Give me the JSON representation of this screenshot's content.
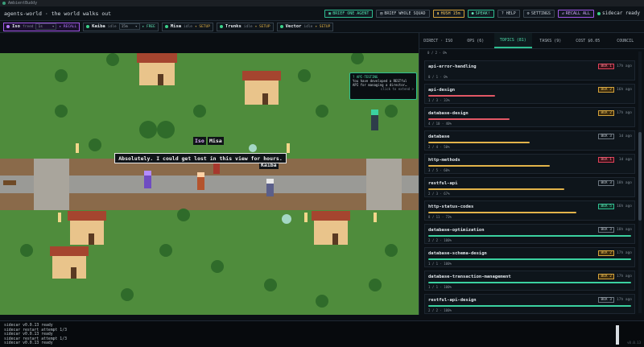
{
  "window": {
    "app_name": "AmbientBuddy"
  },
  "header": {
    "title": "agents-world · the world walks out",
    "buttons": [
      {
        "label": "BRIEF ONE AGENT",
        "style": "green"
      },
      {
        "label": "BRIEF WHOLE SQUAD",
        "style": "plain"
      },
      {
        "label": "HUSH 15m",
        "style": "amber"
      },
      {
        "label": "SPEAK!",
        "style": "mint"
      },
      {
        "label": "? HELP",
        "style": "plain"
      },
      {
        "label": "SETTINGS",
        "style": "plain"
      },
      {
        "label": "RECALL ALL",
        "style": "purple"
      }
    ],
    "status": "sidecar ready"
  },
  "agents": [
    {
      "name": "Iso",
      "state": "freed",
      "select": "1s",
      "action": "RECALL",
      "active": true
    },
    {
      "name": "Kaiba",
      "state": "idle",
      "select": "15m",
      "action": "FREE"
    },
    {
      "name": "Misa",
      "state": "idle",
      "action": "SETUP"
    },
    {
      "name": "Trunks",
      "state": "idle",
      "action": "SETUP"
    },
    {
      "name": "Vector",
      "state": "idle",
      "action": "SETUP"
    }
  ],
  "game": {
    "dialogue": "Absolutely. I could get lost in this view for hours.",
    "nameplates": [
      "Iso",
      "Misa",
      "Kaiba"
    ],
    "tooltip": {
      "head": "? API-TESTING",
      "body": "You have developed a RESTful API for managing a director…",
      "cta": "click to extend >"
    }
  },
  "panel": {
    "tabs": [
      "DIRECT · ISO",
      "OPS (6)",
      "TOPICS (81)",
      "TASKS (9)",
      "COST $0.05",
      "COUNCIL"
    ],
    "active_tab": 2,
    "top_stat": "0 / 2 · 0%",
    "topics": [
      {
        "name": "api-error-handling",
        "badge": "BOX 1",
        "badge_style": "red",
        "age": "17h ago",
        "progress": 0.0,
        "bar_style": "red",
        "stat": "0 / 1 · 0%"
      },
      {
        "name": "api-design",
        "badge": "BOX 2",
        "badge_style": "amber",
        "age": "16h ago",
        "progress": 0.33,
        "bar_style": "red",
        "stat": "1 / 3 · 33%"
      },
      {
        "name": "database-design",
        "badge": "BOX 2",
        "badge_style": "amber",
        "age": "17h ago",
        "progress": 0.4,
        "bar_style": "red",
        "stat": "4 / 10 · 40%"
      },
      {
        "name": "database",
        "badge": "BOX 3",
        "badge_style": "plain",
        "age": "1d ago",
        "progress": 0.5,
        "bar_style": "amber",
        "stat": "2 / 4 · 50%"
      },
      {
        "name": "http-methods",
        "badge": "BOX 1",
        "badge_style": "red",
        "age": "1d ago",
        "progress": 0.6,
        "bar_style": "amber",
        "stat": "3 / 5 · 60%"
      },
      {
        "name": "restful-api",
        "badge": "BOX 3",
        "badge_style": "plain",
        "age": "18h ago",
        "progress": 0.67,
        "bar_style": "amber",
        "stat": "2 / 3 · 67%"
      },
      {
        "name": "http-status-codes",
        "badge": "BOX 5",
        "badge_style": "green",
        "age": "16h ago",
        "progress": 0.73,
        "bar_style": "amber",
        "stat": "8 / 11 · 73%"
      },
      {
        "name": "database-optimization",
        "badge": "BOX 3",
        "badge_style": "plain",
        "age": "18h ago",
        "progress": 1.0,
        "bar_style": "green",
        "stat": "2 / 2 · 100%"
      },
      {
        "name": "database-schema-design",
        "badge": "BOX 2",
        "badge_style": "amber",
        "age": "17h ago",
        "progress": 1.0,
        "bar_style": "green",
        "stat": "1 / 1 · 100%"
      },
      {
        "name": "database-transaction-management",
        "badge": "BOX 2",
        "badge_style": "amber",
        "age": "17h ago",
        "progress": 1.0,
        "bar_style": "green",
        "stat": "1 / 1 · 100%"
      },
      {
        "name": "restful-api-design",
        "badge": "BOX 3",
        "badge_style": "plain",
        "age": "17h ago",
        "progress": 1.0,
        "bar_style": "green",
        "stat": "2 / 2 · 100%"
      }
    ]
  },
  "log": {
    "lines": [
      "sidecar v0.0.13 ready",
      "sidecar restart attempt 1/3",
      "sidecar v0.0.13 ready",
      "sidecar restart attempt 1/3",
      "sidecar v0.0.13 ready"
    ],
    "version": "v0.0.13"
  }
}
